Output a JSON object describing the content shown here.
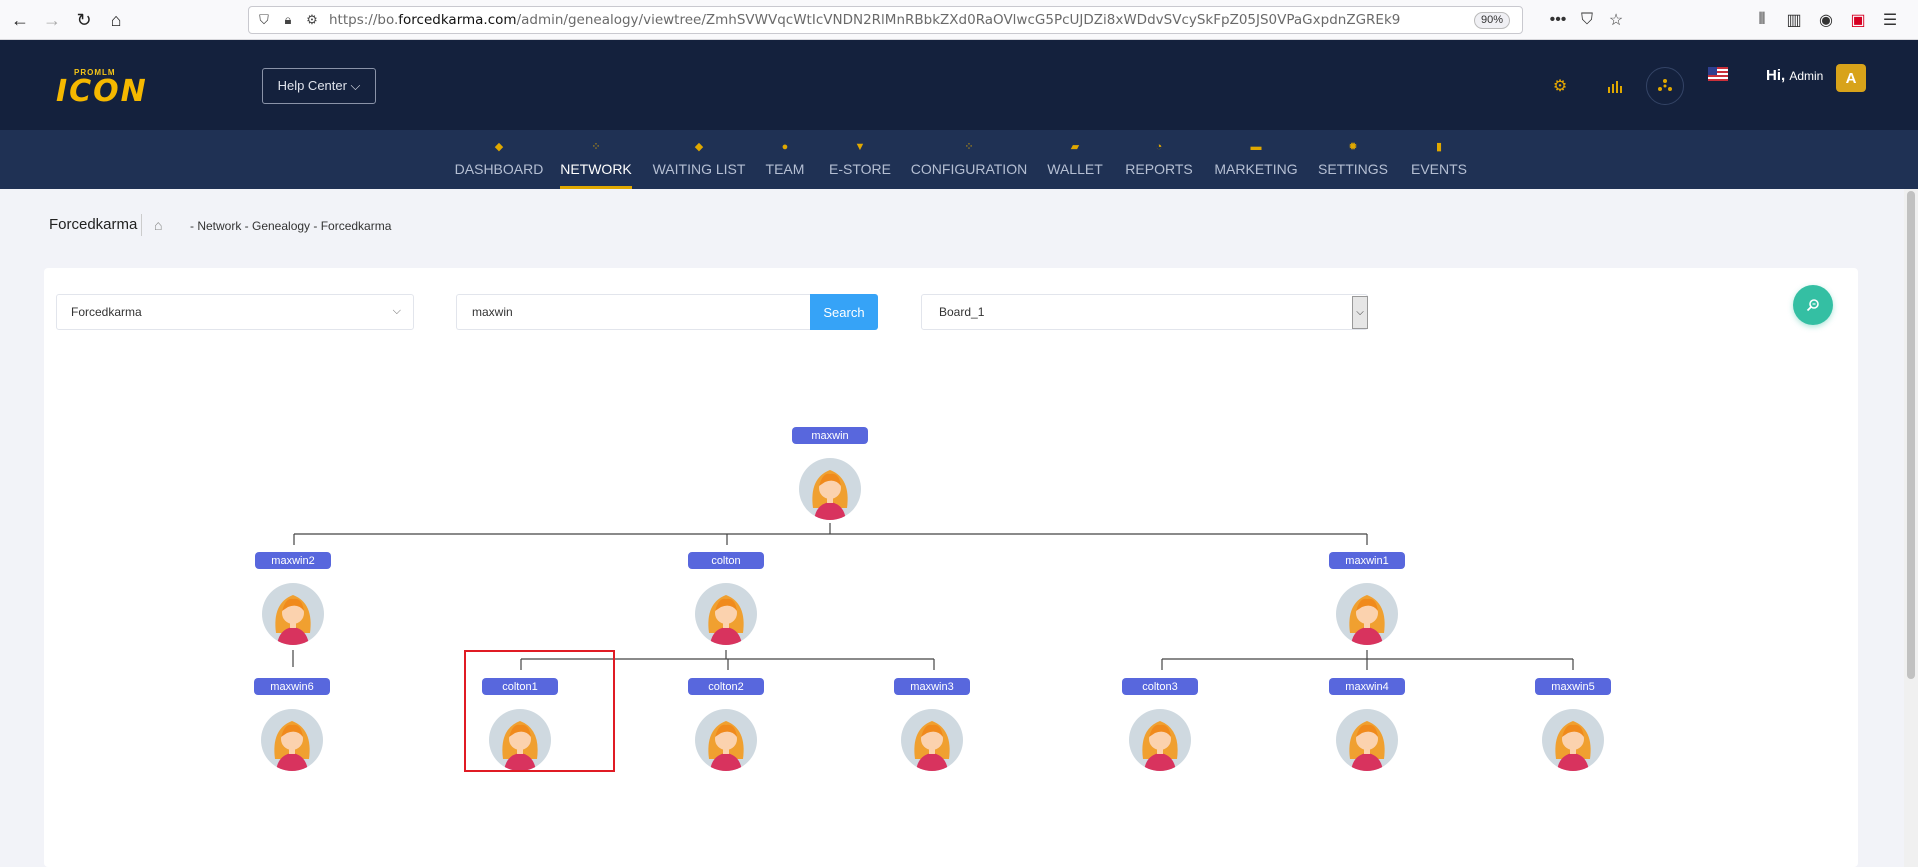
{
  "browser": {
    "url_prefix": "https://bo.",
    "url_domain": "forcedkarma.com",
    "url_path": "/admin/genealogy/viewtree/ZmhSVWVqcWtIcVNDN2RlMnRBbkZXd0RaOVlwcG5PcUJDZi8xWDdvSVcySkFpZ05JS0VPaGxpdnZGREk9",
    "zoom": "90%"
  },
  "header": {
    "logo_small": "PROMLM",
    "logo_big": "ICON",
    "help_center": "Help Center ⌵",
    "greeting": "Hi,",
    "user": "Admin",
    "avatar_initial": "A"
  },
  "nav": {
    "items": [
      {
        "label": "DASHBOARD",
        "icon": "diamond-icon"
      },
      {
        "label": "NETWORK",
        "icon": "network-icon"
      },
      {
        "label": "WAITING LIST",
        "icon": "diamond-icon"
      },
      {
        "label": "TEAM",
        "icon": "team-icon"
      },
      {
        "label": "E-STORE",
        "icon": "basket-icon"
      },
      {
        "label": "CONFIGURATION",
        "icon": "config-icon"
      },
      {
        "label": "WALLET",
        "icon": "wallet-icon"
      },
      {
        "label": "REPORTS",
        "icon": "pie-icon"
      },
      {
        "label": "MARKETING",
        "icon": "briefcase-icon"
      },
      {
        "label": "SETTINGS",
        "icon": "gear-icon"
      },
      {
        "label": "EVENTS",
        "icon": "document-icon"
      }
    ],
    "active": "NETWORK"
  },
  "breadcrumb": {
    "title": "Forcedkarma",
    "path": "- Network - Genealogy - Forcedkarma"
  },
  "filters": {
    "board_select": "Forcedkarma",
    "search_value": "maxwin",
    "search_button": "Search",
    "round_select": "Board_1"
  },
  "tree": {
    "root": "maxwin",
    "level1": [
      "maxwin2",
      "colton",
      "maxwin1"
    ],
    "level2": [
      "maxwin6",
      "colton1",
      "colton2",
      "maxwin3",
      "colton3",
      "maxwin4",
      "maxwin5"
    ],
    "highlighted": "colton1"
  }
}
